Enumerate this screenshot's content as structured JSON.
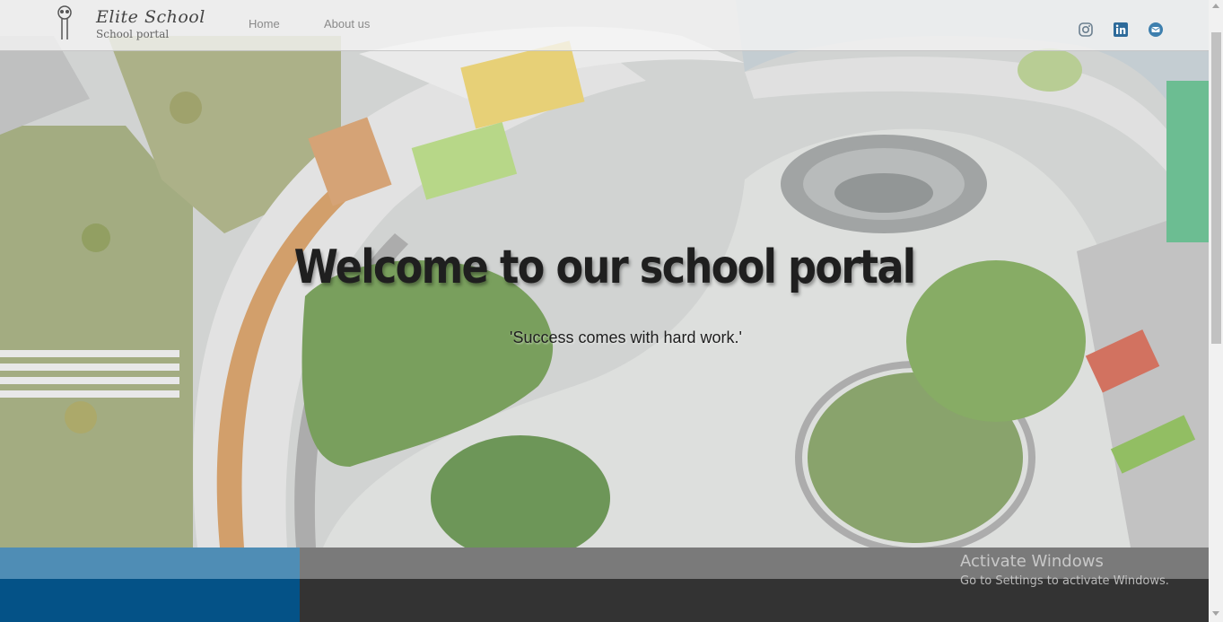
{
  "header": {
    "brand_name": "Elite School",
    "brand_tagline": "School portal",
    "logo_icon": "school-key-icon",
    "nav": [
      {
        "label": "Home"
      },
      {
        "label": "About us"
      }
    ],
    "social": [
      {
        "icon": "instagram-icon"
      },
      {
        "icon": "linkedin-icon"
      },
      {
        "icon": "mail-icon"
      }
    ]
  },
  "hero": {
    "title": "Welcome to our school portal",
    "quote": "'Success comes with hard work.'"
  },
  "watermark": {
    "title": "Activate Windows",
    "subtitle": "Go to Settings to activate Windows."
  },
  "colors": {
    "band_blue_light": "#4f8db5",
    "band_blue_dark": "#045287",
    "band_gray_light": "#7a7a7a",
    "band_gray_dark": "#333333",
    "title_text": "#1f1f1f"
  }
}
